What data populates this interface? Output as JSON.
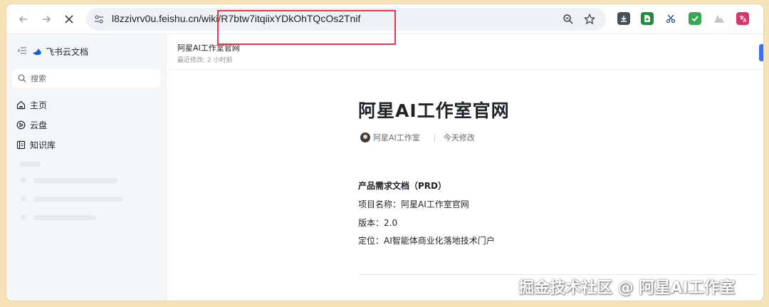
{
  "browser": {
    "url": "l8zzivrv0u.feishu.cn/wiki/R7btw7itqiixYDkOhTQcOs2Tnif"
  },
  "sidebar": {
    "brand": "飞书云文档",
    "search_placeholder": "搜索",
    "items": [
      {
        "label": "主页"
      },
      {
        "label": "云盘"
      },
      {
        "label": "知识库"
      }
    ]
  },
  "doc_header": {
    "title": "阿星AI工作室官网",
    "last_modified": "最近修改: 2 小时前"
  },
  "document": {
    "title": "阿星AI工作室官网",
    "author": "阿星AI工作室",
    "modified": "今天修改",
    "lines": [
      "产品需求文档（PRD）",
      "项目名称：阿星AI工作室官网",
      "版本：2.0",
      "定位：AI智能体商业化落地技术门户"
    ]
  },
  "watermark": "掘金技术社区 @ 阿星AI工作室",
  "colors": {
    "highlight": "#e8394a",
    "accent": "#3370ff",
    "background": "#f6e3b8"
  }
}
